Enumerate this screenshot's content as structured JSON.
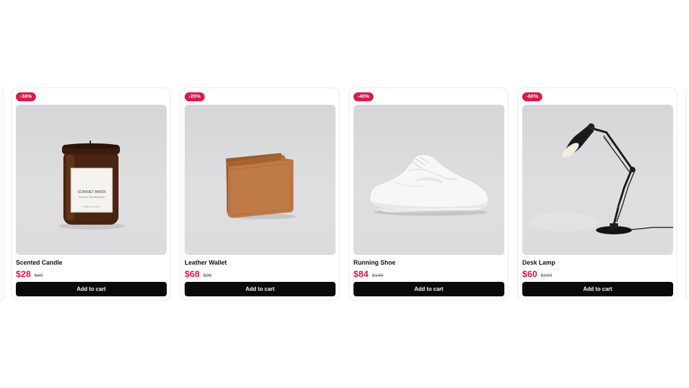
{
  "products": [
    {
      "discount": "-30%",
      "name": "Scented Candle",
      "price": "$28",
      "old_price": "$40",
      "cta": "Add to cart",
      "image": "candle-image",
      "label_line1": "SCANNET MWEN",
      "label_line2": "ENTRADAN OE ETEBE RRORE",
      "label_line3": "THREE WICK CANDLE"
    },
    {
      "discount": "-20%",
      "name": "Leather Wallet",
      "price": "$68",
      "old_price": "$85",
      "cta": "Add to cart",
      "image": "wallet-image"
    },
    {
      "discount": "-40%",
      "name": "Running Shoe",
      "price": "$84",
      "old_price": "$140",
      "cta": "Add to cart",
      "image": "shoe-image"
    },
    {
      "discount": "-60%",
      "name": "Desk Lamp",
      "price": "$60",
      "old_price": "$150",
      "cta": "Add to cart",
      "image": "lamp-image"
    }
  ],
  "colors": {
    "accent": "#d81b48",
    "button": "#0a0a0a",
    "image_bg": "#d9d9dc"
  }
}
